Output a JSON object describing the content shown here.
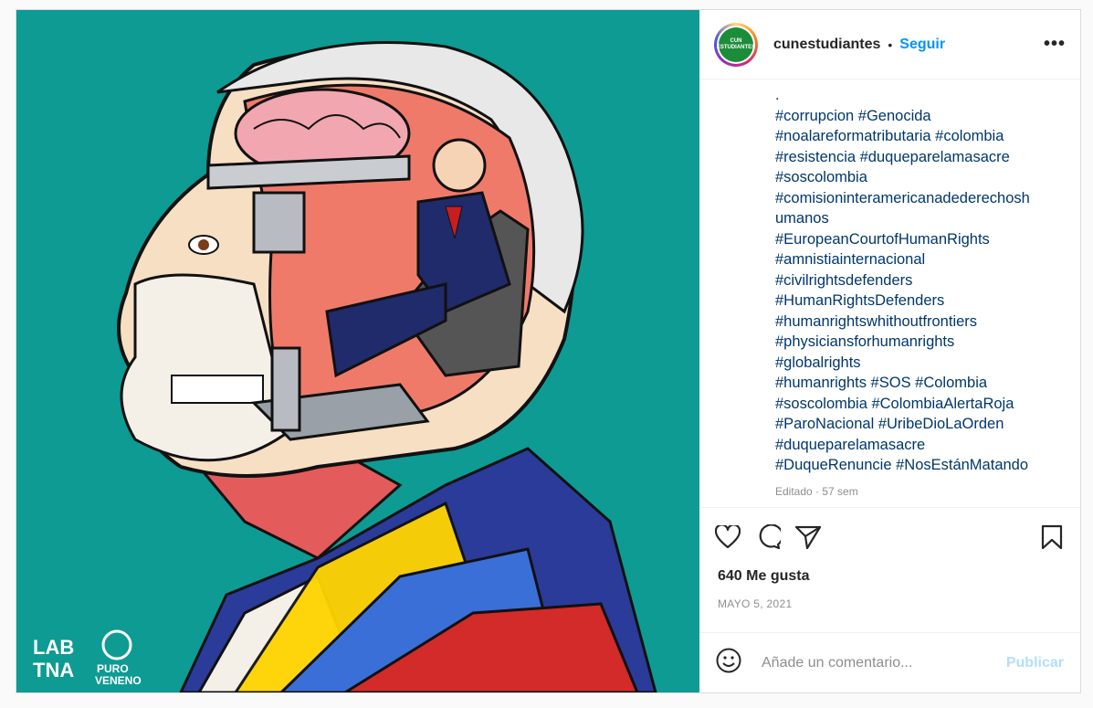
{
  "post": {
    "username": "cunestudiantes",
    "separator": "•",
    "follow_label": "Seguir",
    "more_label": "•••",
    "avatar_text": "CUN ESTUDIANTES",
    "caption_lines": [
      ".",
      "#corrupcion #Genocida",
      "#noalareformatributaria #colombia",
      "#resistencia #duqueparelamasacre",
      "#soscolombia",
      "#comisioninteramericanadederechosh",
      "umanos",
      "#EuropeanCourtofHumanRights",
      "#amnistiainternacional",
      "#civilrightsdefenders",
      "#HumanRightsDefenders",
      "#humanrightswhithoutfrontiers",
      "#physiciansforhumanrights",
      "#globalrights",
      "#humanrights #SOS #Colombia",
      "#soscolombia #ColombiaAlertaRoja",
      "#ParoNacional #UribeDioLaOrden",
      "#duqueparelamasacre",
      "#DuqueRenuncie #NosEstánMatando"
    ],
    "edited": "Editado · 57 sem",
    "likes": "640 Me gusta",
    "date": "MAYO 5, 2021",
    "comment_placeholder": "Añade un comentario...",
    "publish_label": "Publicar",
    "watermark_left": "LAB TNA",
    "watermark_right": "PURO VENENO"
  },
  "icons": [
    "heart-icon",
    "comment-icon",
    "share-icon",
    "bookmark-icon",
    "emoji-icon"
  ],
  "colors": {
    "accent": "#0095f6",
    "image_bg": "#0d9b93"
  }
}
